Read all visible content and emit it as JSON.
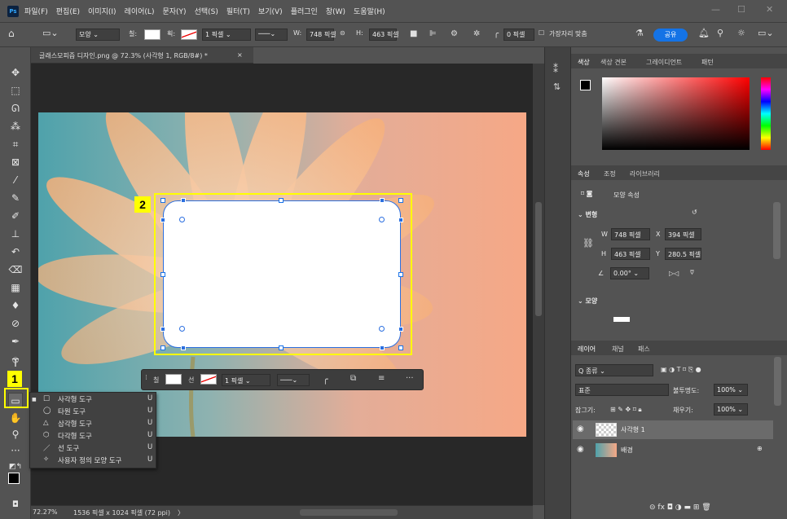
{
  "app": {
    "logo": "Ps"
  },
  "menu": [
    "파일(F)",
    "편집(E)",
    "이미지(I)",
    "레이어(L)",
    "문자(Y)",
    "선택(S)",
    "필터(T)",
    "보기(V)",
    "플러그인",
    "창(W)",
    "도움말(H)"
  ],
  "window_controls": {
    "minimize": "—",
    "maximize": "☐",
    "close": "✕"
  },
  "options": {
    "mode": "모양",
    "fill_label": "칠:",
    "stroke_label": "획:",
    "stroke_width": "1 픽셀",
    "w_label": "W:",
    "w_value": "748 픽셀",
    "h_label": "H:",
    "h_value": "463 픽셀",
    "radius": "0 픽셀",
    "align_edges": "가장자리 맞춤",
    "share": "공유"
  },
  "document": {
    "tab_title": "글래스모피즘 디자인.png @ 72.3% (사각형 1, RGB/8#) *",
    "close": "×"
  },
  "status": {
    "zoom": "72.27%",
    "info": "1536 픽셀 x 1024 픽셀 (72 ppi)",
    "arrow": "〉"
  },
  "badges": {
    "one": "1",
    "two": "2"
  },
  "tool_flyout": {
    "items": [
      {
        "icon": "□",
        "label": "사각형 도구",
        "key": "U",
        "selected": true
      },
      {
        "icon": "◯",
        "label": "타원 도구",
        "key": "U"
      },
      {
        "icon": "△",
        "label": "삼각형 도구",
        "key": "U"
      },
      {
        "icon": "⬡",
        "label": "다각형 도구",
        "key": "U"
      },
      {
        "icon": "／",
        "label": "선 도구",
        "key": "U"
      },
      {
        "icon": "✧",
        "label": "사용자 정의 모양 도구",
        "key": "U"
      }
    ]
  },
  "context_bar": {
    "fill_label": "칠",
    "stroke_label": "선",
    "stroke_width": "1 픽셀",
    "more": "···"
  },
  "color_panel": {
    "tabs": [
      "색상",
      "색상 견본",
      "그레이디언트",
      "패턴"
    ]
  },
  "properties_panel": {
    "tabs": [
      "속성",
      "조정",
      "라이브러리"
    ],
    "shape_props": "모양 속성",
    "transform_label": "변형",
    "w_label": "W",
    "w_value": "748 픽셀",
    "x_label": "X",
    "x_value": "394 픽셀",
    "h_label": "H",
    "h_value": "463 픽셀",
    "y_label": "Y",
    "y_value": "280.5 픽셀",
    "angle": "0.00°",
    "shape_label": "모양"
  },
  "layers_panel": {
    "tabs": [
      "레이어",
      "채널",
      "패스"
    ],
    "kind": "Q 종류",
    "blend": "표준",
    "opacity_label": "불투명도:",
    "opacity": "100%",
    "lock_label": "잠그기:",
    "fill_label": "채우기:",
    "fill": "100%",
    "layers": [
      {
        "name": "사각형 1",
        "selected": true
      },
      {
        "name": "배경",
        "locked": true
      }
    ]
  }
}
